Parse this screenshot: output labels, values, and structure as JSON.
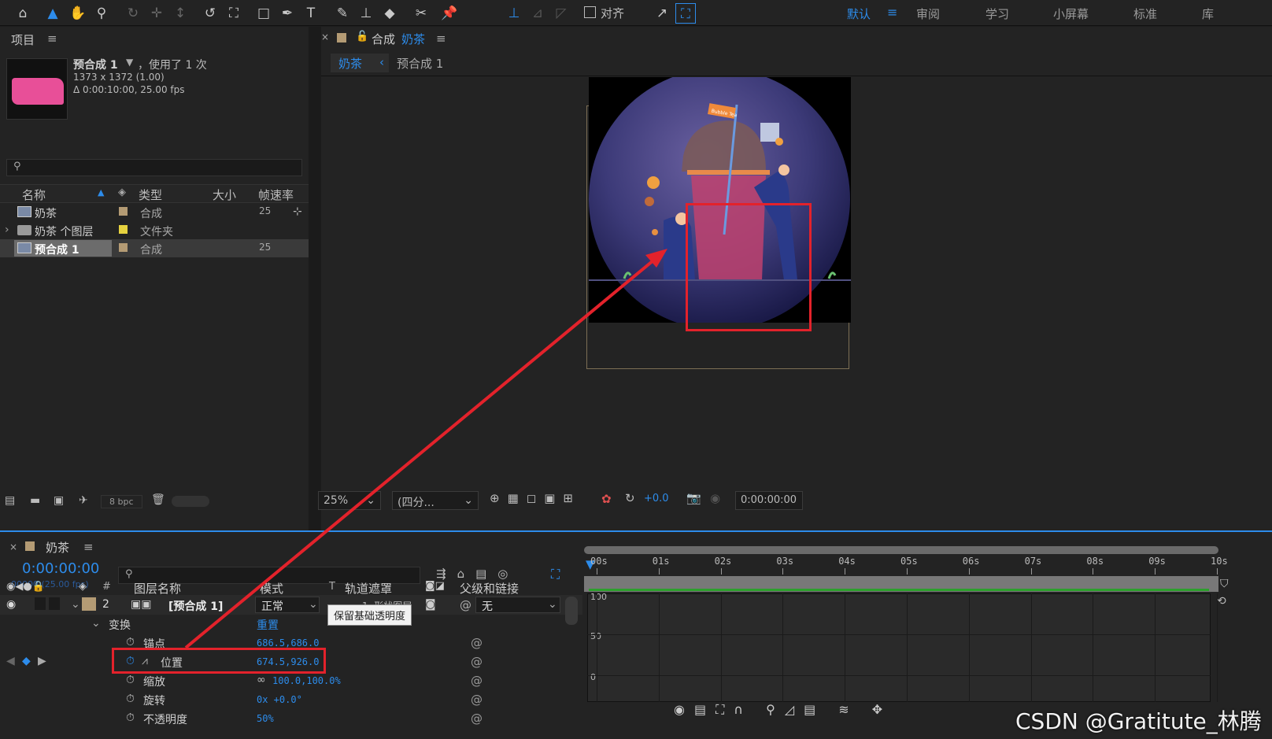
{
  "toolbar": {
    "icons": [
      "home-icon",
      "selection-arrow-icon",
      "hand-icon",
      "zoom-icon",
      "orbit-icon",
      "pan-icon",
      "dolly-icon",
      "rotate-icon",
      "anchor-icon",
      "rect-icon",
      "pen-icon",
      "text-icon",
      "brush-icon",
      "stamp-icon",
      "eraser-icon",
      "roto-icon",
      "puppet-icon"
    ],
    "align_label": "对齐",
    "workspaces": [
      "默认",
      "审阅",
      "学习",
      "小屏幕",
      "标准",
      "库"
    ],
    "active_workspace": "默认"
  },
  "project": {
    "title": "项目",
    "comp_name": "预合成 1",
    "usage": "，使用了 1 次",
    "dimensions": "1373 x 1372 (1.00)",
    "duration": "Δ 0:00:10:00, 25.00 fps",
    "search_placeholder": "",
    "columns": {
      "name": "名称",
      "type": "类型",
      "size": "大小",
      "fps": "帧速率"
    },
    "items": [
      {
        "name": "奶茶",
        "type": "合成",
        "fps": "25",
        "color": "#b49b74"
      },
      {
        "name": "奶茶 个图层",
        "type": "文件夹",
        "fps": "",
        "color": "#e6d23f"
      },
      {
        "name": "预合成 1",
        "type": "合成",
        "fps": "25",
        "color": "#b49b74"
      }
    ],
    "bpc": "8 bpc"
  },
  "viewer": {
    "tab_prefix": "合成",
    "tab_comp": "奶茶",
    "breadcrumb_active": "奶茶",
    "breadcrumb_next": "预合成 1",
    "zoom": "25%",
    "resolution": "(四分...",
    "exposure": "+0.0",
    "timecode": "0:00:00:00",
    "flag_text": "Bubble Tea"
  },
  "timeline": {
    "tab": "奶茶",
    "timecode": "0:00:00:00",
    "frame_info": "00000 (25.00 fps)",
    "search_placeholder": "",
    "columns": {
      "num": "#",
      "name": "图层名称",
      "mode": "模式",
      "t": "T",
      "matte": "轨道遮罩",
      "parent": "父级和链接"
    },
    "layer": {
      "num": "2",
      "name": "[预合成 1]",
      "mode": "正常",
      "matte": "1. 形状图层",
      "parent": "无"
    },
    "tooltip": "保留基础透明度",
    "transform": "变换",
    "reset": "重置",
    "properties": [
      {
        "name": "锚点",
        "value": "686.5,686.0"
      },
      {
        "name": "位置",
        "value": "674.5,926.0"
      },
      {
        "name": "缩放",
        "value": "100.0,100.0%"
      },
      {
        "name": "旋转",
        "value": "0x +0.0°"
      },
      {
        "name": "不透明度",
        "value": "50%"
      }
    ],
    "ruler": [
      "00s",
      "01s",
      "02s",
      "03s",
      "04s",
      "05s",
      "06s",
      "07s",
      "08s",
      "09s",
      "10s"
    ],
    "graph_labels": [
      "100",
      "50",
      "0"
    ]
  },
  "watermark": "CSDN @Gratitute_林腾"
}
